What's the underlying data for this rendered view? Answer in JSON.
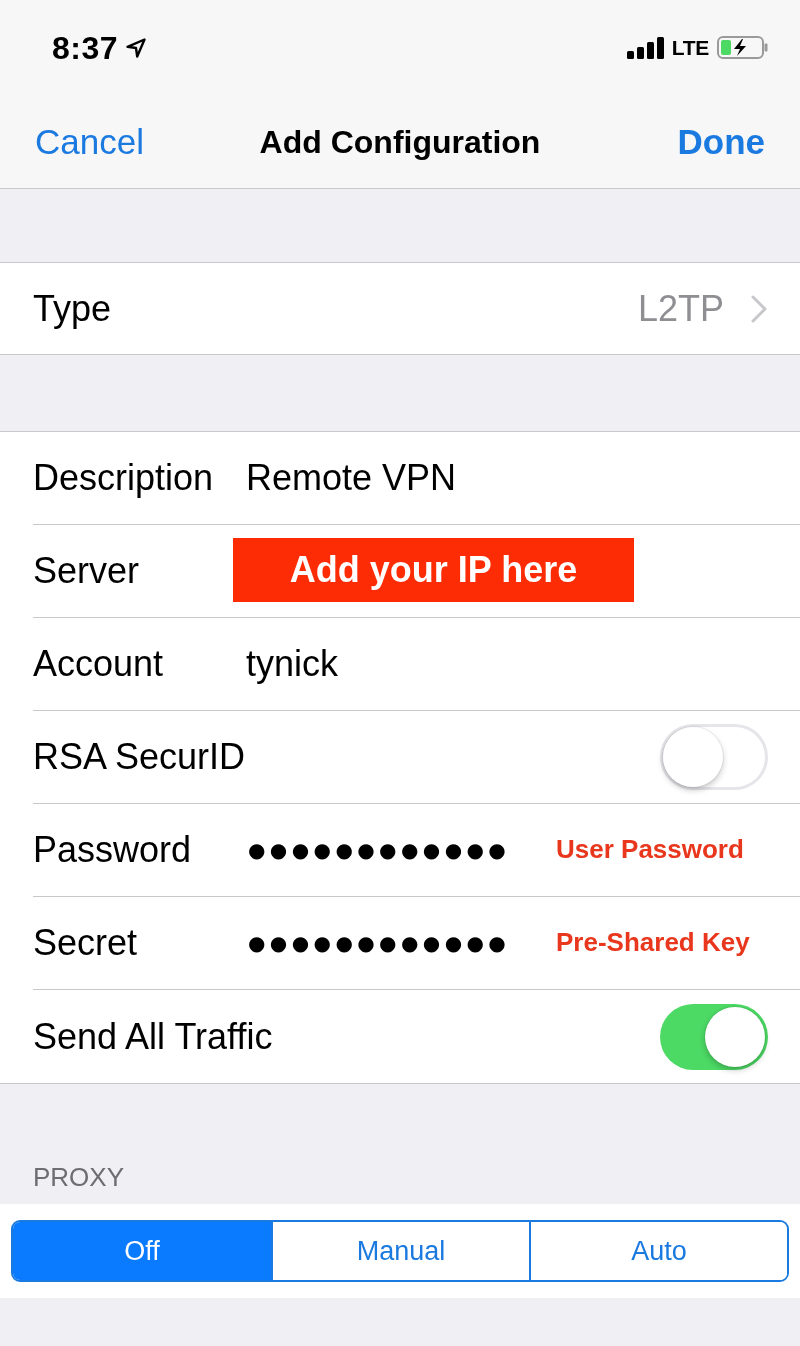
{
  "status_bar": {
    "time": "8:37",
    "network": "LTE"
  },
  "nav_bar": {
    "cancel": "Cancel",
    "title": "Add Configuration",
    "done": "Done"
  },
  "type_row": {
    "label": "Type",
    "value": "L2TP"
  },
  "fields": [
    {
      "kind": "text",
      "label": "Description",
      "value": "Remote VPN"
    },
    {
      "kind": "text",
      "label": "Server",
      "annotation": {
        "kind": "banner",
        "text": "Add your IP here"
      }
    },
    {
      "kind": "text",
      "label": "Account",
      "value": "tynick"
    },
    {
      "kind": "toggle",
      "label": "RSA SecurID",
      "on": false
    },
    {
      "kind": "secure",
      "label": "Password",
      "value": "●●●●●●●●●●●●",
      "annotation": {
        "kind": "note",
        "text": "User Password"
      }
    },
    {
      "kind": "secure",
      "label": "Secret",
      "value": "●●●●●●●●●●●●",
      "annotation": {
        "kind": "note",
        "text": "Pre-Shared Key"
      }
    },
    {
      "kind": "toggle",
      "label": "Send All Traffic",
      "on": true
    }
  ],
  "proxy": {
    "header": "PROXY",
    "options": [
      {
        "label": "Off",
        "selected": true
      },
      {
        "label": "Manual",
        "selected": false
      },
      {
        "label": "Auto",
        "selected": false
      }
    ]
  }
}
